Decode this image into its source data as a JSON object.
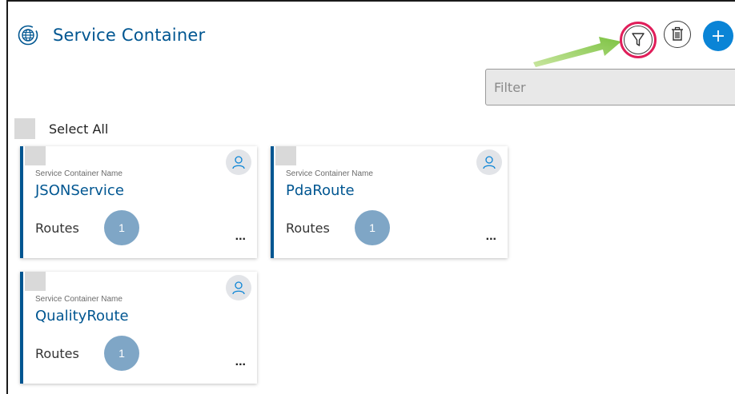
{
  "header": {
    "title": "Service Container",
    "app_icon": "globe-service-icon",
    "actions": {
      "filter_icon": "filter-icon",
      "delete_icon": "trash-icon",
      "add_icon": "plus-icon"
    }
  },
  "filter": {
    "placeholder": "Filter",
    "value": ""
  },
  "select_all": {
    "label": "Select All",
    "checked": false
  },
  "cards": [
    {
      "caption": "Service Container Name",
      "name": "JSONService",
      "routes_label": "Routes",
      "routes_count": "1",
      "more": "..."
    },
    {
      "caption": "Service Container Name",
      "name": "PdaRoute",
      "routes_label": "Routes",
      "routes_count": "1",
      "more": "..."
    },
    {
      "caption": "Service Container Name",
      "name": "QualityRoute",
      "routes_label": "Routes",
      "routes_count": "1",
      "more": "..."
    }
  ],
  "colors": {
    "brand": "#005691",
    "highlight": "#e01e5a",
    "add_button": "#0a84d6",
    "routes_badge": "#7fa6c6",
    "annotation_arrow": "#8dc63f"
  }
}
